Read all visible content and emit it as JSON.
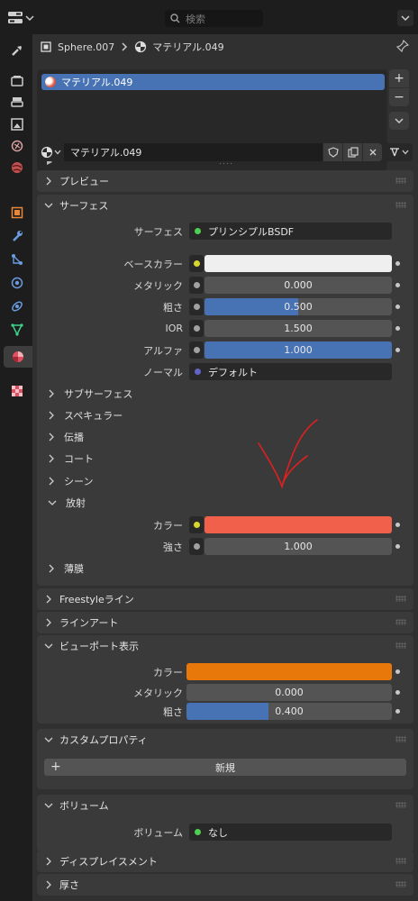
{
  "topbar": {
    "search_placeholder": "検索"
  },
  "breadcrumb": {
    "object": "Sphere.007",
    "material": "マテリアル.049"
  },
  "material_slots": {
    "items": [
      "マテリアル.049"
    ],
    "add": "+",
    "remove": "−"
  },
  "datablock": {
    "name": "マテリアル.049"
  },
  "panels": {
    "preview": "プレビュー",
    "surface": {
      "title": "サーフェス",
      "surface_label": "サーフェス",
      "surface_value": "プリンシプルBSDF",
      "base_color_label": "ベースカラー",
      "base_color": "#efefef",
      "metallic_label": "メタリック",
      "metallic": "0.000",
      "roughness_label": "粗さ",
      "roughness": "0.500",
      "roughness_fill": 0.5,
      "ior_label": "IOR",
      "ior": "1.500",
      "alpha_label": "アルファ",
      "alpha": "1.000",
      "alpha_fill": 1.0,
      "normal_label": "ノーマル",
      "normal_value": "デフォルト",
      "subsections": [
        "サブサーフェス",
        "スペキュラー",
        "伝播",
        "コート",
        "シーン"
      ],
      "emission": {
        "title": "放射",
        "color_label": "カラー",
        "color": "#f0604a",
        "strength_label": "強さ",
        "strength": "1.000"
      },
      "thin_film": "薄膜"
    },
    "freestyle": "Freestyleライン",
    "lineart": "ラインアート",
    "viewport": {
      "title": "ビューポート表示",
      "color_label": "カラー",
      "color": "#e8780a",
      "metallic_label": "メタリック",
      "metallic": "0.000",
      "roughness_label": "粗さ",
      "roughness": "0.400",
      "roughness_fill": 0.4
    },
    "custom_props": {
      "title": "カスタムプロパティ",
      "new_button": "新規"
    },
    "volume": {
      "title": "ボリューム",
      "label": "ボリューム",
      "value": "なし"
    },
    "displacement": "ディスプレイスメント",
    "thickness": "厚さ"
  },
  "colors": {
    "accent": "#4772b3",
    "socket_yellow": "#d6d62e",
    "socket_grey": "#a1a1a1",
    "socket_green": "#4fcf52",
    "socket_purple": "#6363c7",
    "annotation_red": "#e02020"
  }
}
